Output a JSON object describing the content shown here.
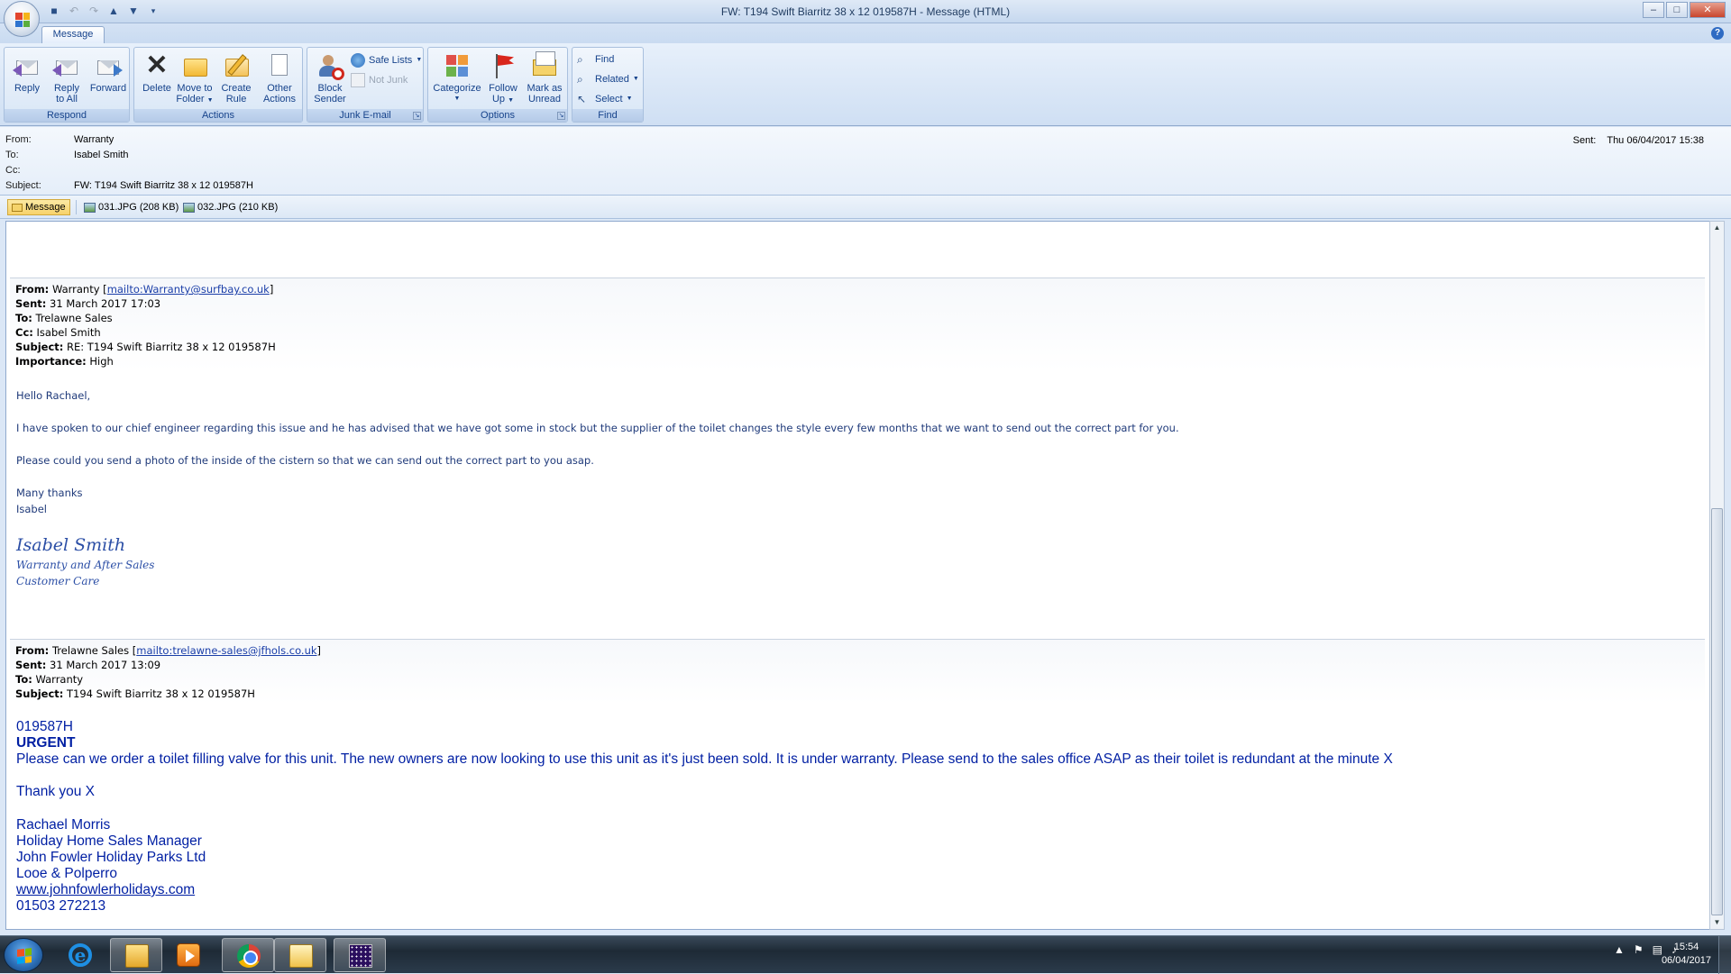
{
  "window": {
    "title": "FW: T194 Swift Biarritz 38 x 12 019587H  -  Message (HTML)",
    "minimize": "–",
    "maximize": "□",
    "close": "✕"
  },
  "quick_access": [
    "save-icon",
    "undo-icon",
    "redo-icon",
    "previous-item-icon",
    "next-item-icon",
    "customize-icon"
  ],
  "tabs": {
    "message": "Message",
    "help": "?"
  },
  "ribbon": {
    "respond": {
      "label": "Respond",
      "reply_1": "Reply",
      "reply_all_1": "Reply",
      "reply_all_2": "to All",
      "forward_1": "Forward"
    },
    "actions": {
      "label": "Actions",
      "delete": "Delete",
      "move_1": "Move to",
      "move_2": "Folder",
      "create_1": "Create",
      "create_2": "Rule",
      "other_1": "Other",
      "other_2": "Actions"
    },
    "junk": {
      "label": "Junk E-mail",
      "block_1": "Block",
      "block_2": "Sender",
      "safe_lists": "Safe Lists",
      "not_junk": "Not Junk"
    },
    "options": {
      "label": "Options",
      "categorize": "Categorize",
      "follow_1": "Follow",
      "follow_2": "Up",
      "mark_1": "Mark as",
      "mark_2": "Unread"
    },
    "find": {
      "label": "Find",
      "find": "Find",
      "related": "Related",
      "select": "Select"
    }
  },
  "header": {
    "from_label": "From:",
    "from_value": "Warranty",
    "to_label": "To:",
    "to_value": "Isabel Smith",
    "cc_label": "Cc:",
    "cc_value": "",
    "subject_label": "Subject:",
    "subject_value": "FW: T194 Swift Biarritz 38 x 12 019587H",
    "sent_label": "Sent:",
    "sent_value": "Thu 06/04/2017 15:38"
  },
  "attachments": {
    "message": "Message",
    "file1": "031.JPG (208 KB)",
    "file2": "032.JPG (210 KB)"
  },
  "email1": {
    "from_label": "From:",
    "from_name": "Warranty",
    "from_link": "mailto:Warranty@surfbay.co.uk",
    "sent_label": "Sent:",
    "sent_value": "31 March 2017 17:03",
    "to_label": "To:",
    "to_value": "Trelawne Sales",
    "cc_label": "Cc:",
    "cc_value": "Isabel Smith",
    "subject_label": "Subject:",
    "subject_value": "RE: T194 Swift Biarritz 38 x 12 019587H",
    "importance_label": "Importance:",
    "importance_value": "High",
    "greeting": "Hello Rachael,",
    "para1": "I have spoken to our chief engineer regarding this issue and he has advised that we have got some in stock but the supplier of the toilet changes the style every few months that we want to send out the correct part for you.",
    "para2": "Please could you send a photo of the inside of the cistern so that we can send out the correct part to you asap.",
    "thanks": "Many thanks",
    "name": "Isabel",
    "sig_name": "Isabel Smith",
    "sig_title": "Warranty and After Sales",
    "sig_dept": "Customer Care"
  },
  "email2": {
    "from_label": "From:",
    "from_name": "Trelawne Sales",
    "from_link": "mailto:trelawne-sales@jfhols.co.uk",
    "sent_label": "Sent:",
    "sent_value": "31 March 2017 13:09",
    "to_label": "To:",
    "to_value": "Warranty",
    "subject_label": "Subject:",
    "subject_value": "T194 Swift Biarritz 38 x 12 019587H",
    "ref": "019587H",
    "urgent": "URGENT",
    "body": "Please can we order a toilet filling valve for this unit.  The new owners are now looking to use this unit as it's just been sold.  It is under warranty.  Please send to the sales office ASAP as their toilet is redundant at the minute X",
    "thanks": "Thank you X",
    "sig1": "Rachael Morris",
    "sig2": "Holiday Home Sales Manager",
    "sig3": "John Fowler Holiday Parks Ltd",
    "sig4": "Looe & Polperro",
    "sig5": "www.johnfowlerholidays.com",
    "sig6": "01503 272213"
  },
  "taskbar": {
    "apps": [
      "start-button",
      "internet-explorer",
      "windows-explorer",
      "media-player",
      "google-chrome",
      "outlook",
      "app-window"
    ],
    "time": "15:54",
    "date": "06/04/2017"
  }
}
